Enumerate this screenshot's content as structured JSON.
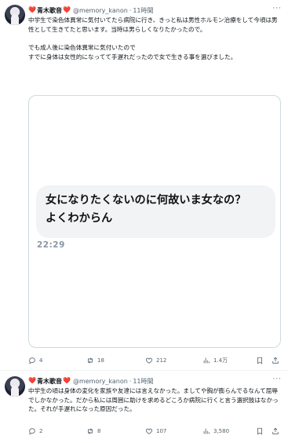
{
  "tweets": [
    {
      "heart_left": "❤️",
      "name": "青木歌音",
      "heart_right": "❤️",
      "handle": "@memory_kanon",
      "separator": "·",
      "time": "11時間",
      "more_label": "···",
      "text": "中学生で染色体異常に気付いてたら病院に行き、きっと私は男性ホルモン治療をして今頃は男性として生きてたと思います。当時は男らしくなりたかったので。\n\nでも成人後に染色体異常に気付いたので\nすでに身体は女性的になってて手遅れだったので女で生きる事を選びました。",
      "media": {
        "bubble_text": "女になりたくないのに何故いま女なの？\nよくわからん",
        "timestamp": "22:29"
      },
      "actions": {
        "replies": "4",
        "retweets": "18",
        "likes": "212",
        "views": "1.4万"
      }
    },
    {
      "heart_left": "❤️",
      "name": "青木歌音",
      "heart_right": "❤️",
      "handle": "@memory_kanon",
      "separator": "·",
      "time": "11時間",
      "more_label": "···",
      "text": "中学生の頃は身体の変化を家族や友達には言えなかった。ましてや胸が膨らんでるなんて屈辱でしかなかった。だから私には周囲に助けを求めるどころか病院に行くと言う選択肢はなかった。それが手遅れになった原因だった。",
      "actions": {
        "replies": "2",
        "retweets": "8",
        "likes": "107",
        "views": "3,580"
      }
    }
  ],
  "icons": {
    "reply": "reply-icon",
    "retweet": "retweet-icon",
    "like": "heart-icon",
    "views": "views-icon",
    "bookmark": "bookmark-icon",
    "share": "share-icon"
  },
  "colors": {
    "heart": "#d0303a",
    "muted": "#536471",
    "border": "#cfd9de",
    "bubble": "#f2f3f5"
  }
}
